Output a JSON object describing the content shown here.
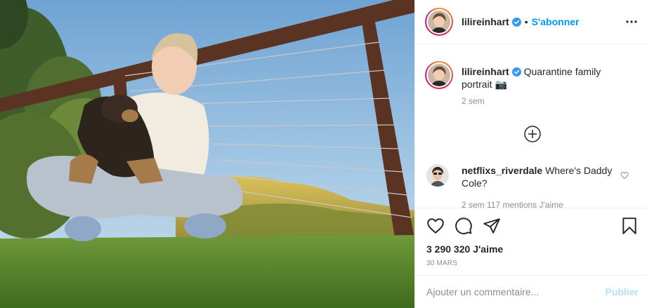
{
  "post": {
    "username": "lilireinhart",
    "verified": true,
    "separator": "•",
    "follow_label": "S'abonner",
    "more_icon": "more-horizontal-icon",
    "photo_description_icon": "photo-post"
  },
  "caption": {
    "username": "lilireinhart",
    "text": "Quarantine family portrait",
    "emoji": "📷",
    "time": "2 sem"
  },
  "load_more_icon": "plus-circle-icon",
  "comments": [
    {
      "username": "netflixs_riverdale",
      "text": "Where's Daddy Cole?",
      "meta": "2 sem  117 mentions J'aime"
    }
  ],
  "actions": {
    "like_icon": "heart-icon",
    "comment_icon": "comment-icon",
    "share_icon": "paper-plane-icon",
    "save_icon": "bookmark-icon",
    "likes_count": "3 290 320",
    "likes_label": "J'aime",
    "date": "30 MARS"
  },
  "add_comment": {
    "placeholder": "Ajouter un commentaire...",
    "publish_label": "Publier"
  },
  "colors": {
    "link": "#0095f6",
    "publish_disabled": "#b2dffc",
    "text": "#262626",
    "muted": "#8e8e8e"
  }
}
